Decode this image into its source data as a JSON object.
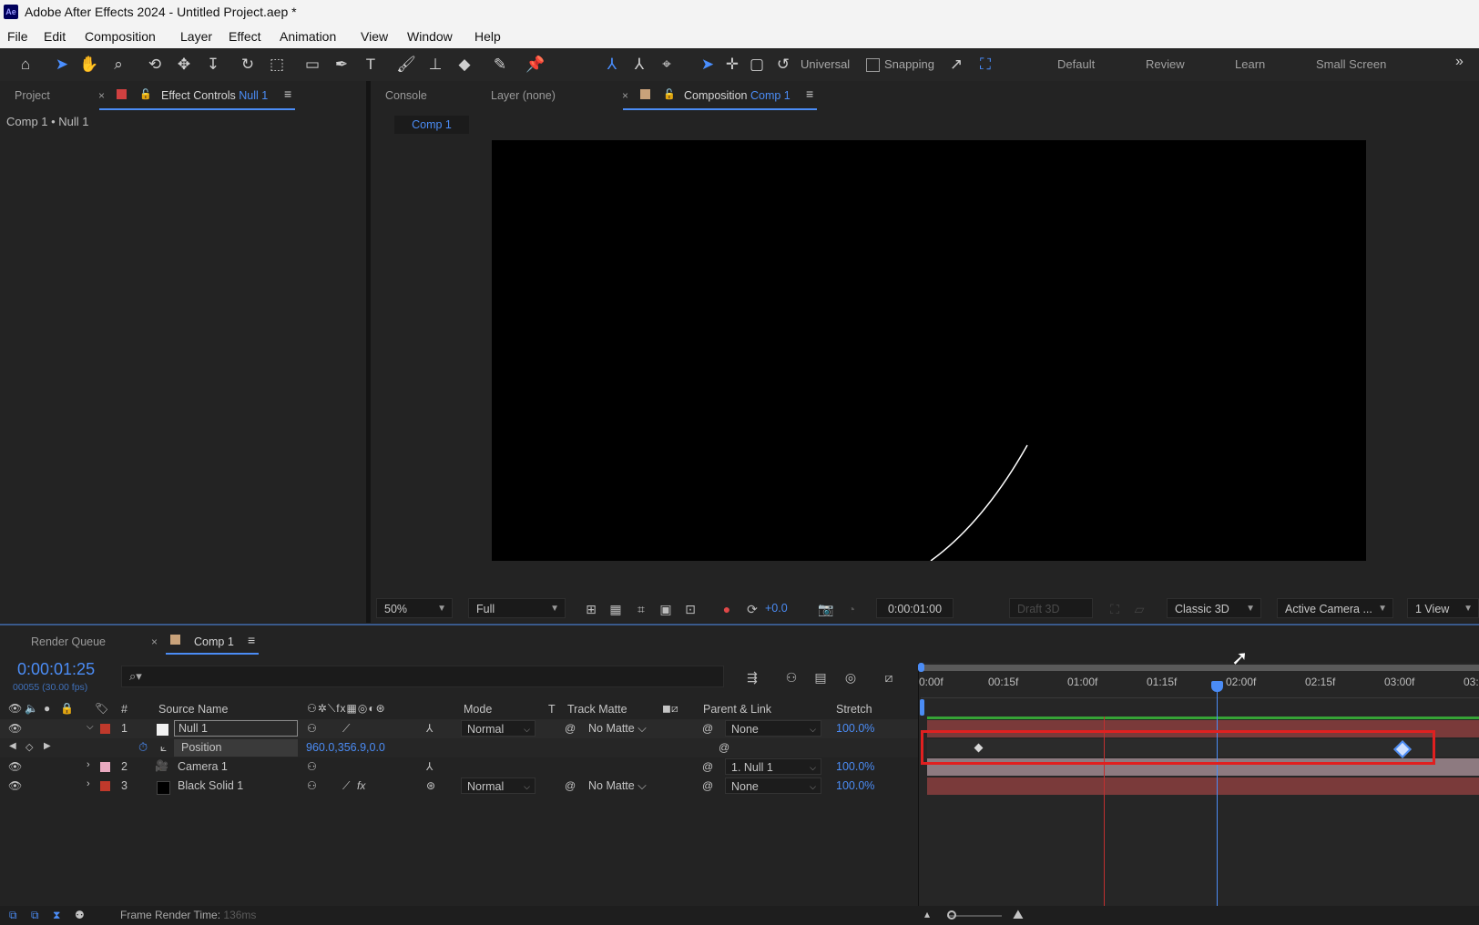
{
  "titlebar": {
    "title": "Adobe After Effects 2024 - Untitled Project.aep *",
    "logo": "Ae"
  },
  "menu": [
    "File",
    "Edit",
    "Composition",
    "Layer",
    "Effect",
    "Animation",
    "View",
    "Window",
    "Help"
  ],
  "toolbar": {
    "axis_mode": "Universal",
    "snapping": "Snapping",
    "workspaces": [
      "Default",
      "Review",
      "Learn",
      "Small Screen"
    ],
    "overflow": "»"
  },
  "left_panel": {
    "tab_project": "Project",
    "tab_effect_controls": "Effect Controls",
    "tab_effect_controls_target": "Null 1",
    "breadcrumb": "Comp 1 • Null 1"
  },
  "viewer": {
    "tab_console": "Console",
    "tab_layer": "Layer (none)",
    "tab_composition": "Composition",
    "tab_composition_target": "Comp 1",
    "flow_tab": "Comp 1",
    "magnification": "50%",
    "resolution": "Full",
    "exposure": "+0.0",
    "timecode": "0:00:01:00",
    "draft3d": "Draft 3D",
    "renderer": "Classic 3D",
    "camera": "Active Camera ...",
    "views": "1 View"
  },
  "timeline": {
    "tab_render_queue": "Render Queue",
    "tab_comp": "Comp 1",
    "current_time": "0:00:01:25",
    "frame_info": "00055 (30.00 fps)",
    "columns": {
      "hash": "#",
      "source_name": "Source Name",
      "mode": "Mode",
      "t": "T",
      "track_matte": "Track Matte",
      "parent_link": "Parent & Link",
      "stretch": "Stretch"
    },
    "layers": [
      {
        "num": "1",
        "name": "Null 1",
        "mode": "Normal",
        "matte": "No Matte",
        "parent": "None",
        "stretch": "100.0%",
        "label_color": "#c0392b"
      },
      {
        "num": "2",
        "name": "Camera 1",
        "parent": "1. Null 1",
        "stretch": "100.0%",
        "label_color": "#e8a9c0"
      },
      {
        "num": "3",
        "name": "Black Solid 1",
        "mode": "Normal",
        "matte": "No Matte",
        "parent": "None",
        "stretch": "100.0%",
        "label_color": "#c0392b"
      }
    ],
    "property": {
      "name": "Position",
      "value": "960.0,356.9,0.0"
    },
    "ruler": [
      "0:00f",
      "00:15f",
      "01:00f",
      "01:15f",
      "02:00f",
      "02:15f",
      "03:00f",
      "03:"
    ],
    "keyframes": [
      "keyframe-1",
      "keyframe-2"
    ],
    "status": "Frame Render Time:",
    "render_time": "136ms"
  },
  "colors": {
    "accent": "#4b8cf5",
    "highlight_box": "#e02020",
    "layer_bar_red": "#7a3a3a",
    "camera_bar_pink": "#8d7a80"
  }
}
